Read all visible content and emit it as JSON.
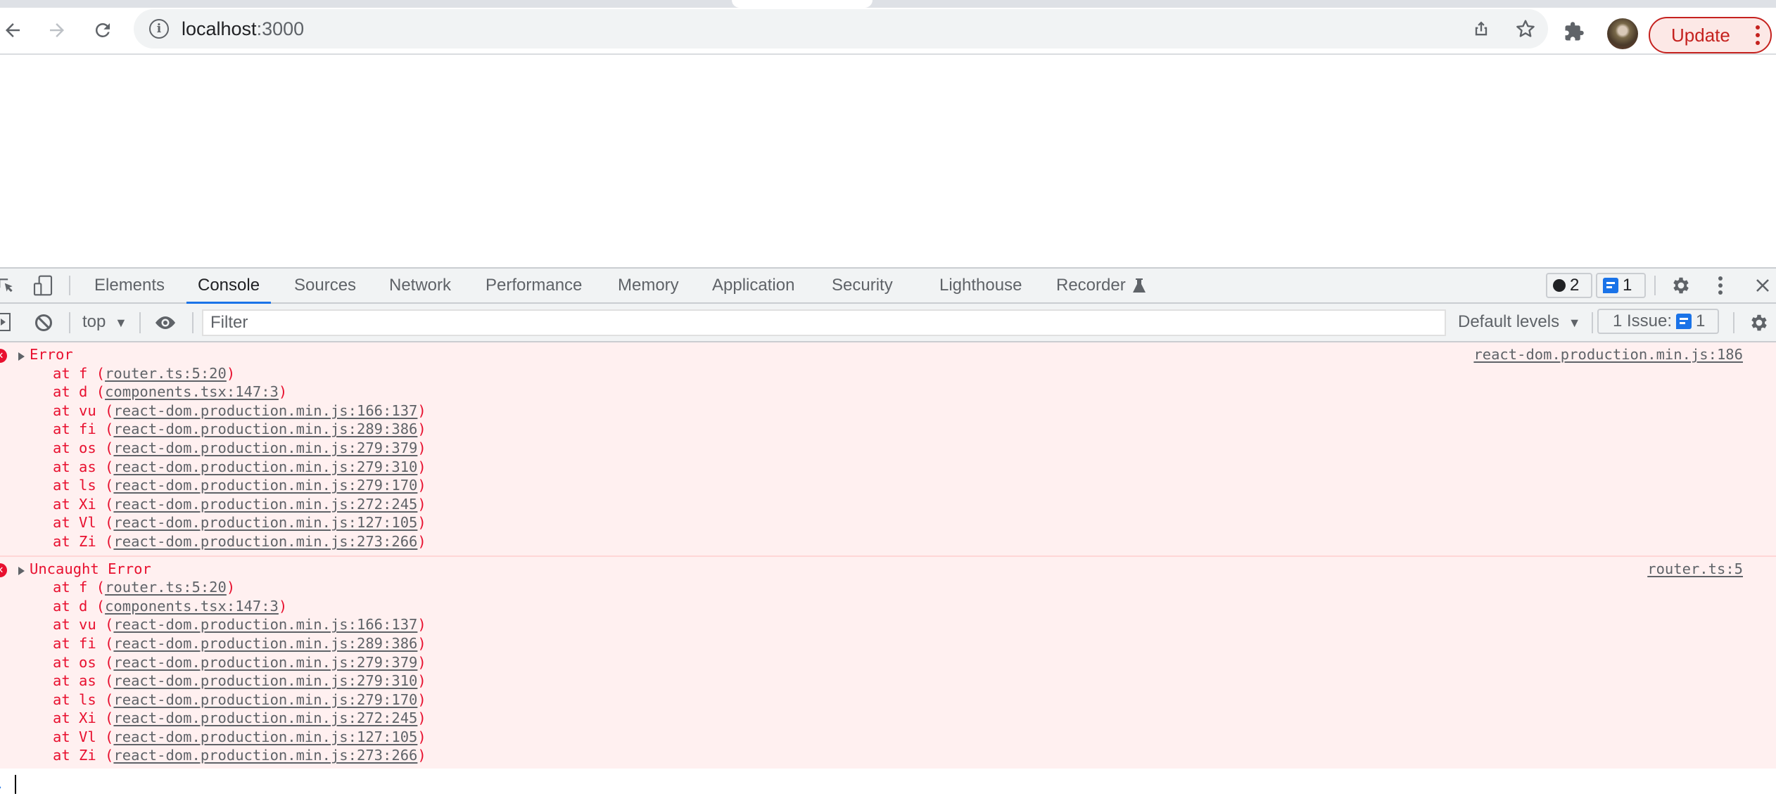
{
  "browser": {
    "url_host": "localhost",
    "url_port": ":3000",
    "update_label": "Update",
    "icons": {
      "back": "arrow-left-icon",
      "forward": "arrow-right-icon",
      "reload": "reload-icon",
      "site_info": "info-icon",
      "share": "share-icon",
      "bookmark": "star-icon",
      "extensions": "puzzle-icon",
      "profile": "avatar",
      "menu": "kebab-icon"
    }
  },
  "devtools": {
    "tabs": [
      {
        "label": "Elements",
        "active": false
      },
      {
        "label": "Console",
        "active": true
      },
      {
        "label": "Sources",
        "active": false
      },
      {
        "label": "Network",
        "active": false
      },
      {
        "label": "Performance",
        "active": false
      },
      {
        "label": "Memory",
        "active": false
      },
      {
        "label": "Application",
        "active": false
      },
      {
        "label": "Security",
        "active": false
      },
      {
        "label": "Lighthouse",
        "active": false
      },
      {
        "label": "Recorder",
        "active": false
      }
    ],
    "error_count": "2",
    "message_count": "1",
    "console_toolbar": {
      "context": "top",
      "filter_placeholder": "Filter",
      "levels": "Default levels",
      "issues_label": "1 Issue:",
      "issues_count": "1"
    },
    "accent_color": "#1a73e8",
    "error_color": "#e8102f"
  },
  "console": {
    "messages": [
      {
        "title": "Error",
        "source": "react-dom.production.min.js:186",
        "frames": [
          {
            "fn": "f",
            "loc": "router.ts:5:20"
          },
          {
            "fn": "d",
            "loc": "components.tsx:147:3"
          },
          {
            "fn": "vu",
            "loc": "react-dom.production.min.js:166:137"
          },
          {
            "fn": "fi",
            "loc": "react-dom.production.min.js:289:386"
          },
          {
            "fn": "os",
            "loc": "react-dom.production.min.js:279:379"
          },
          {
            "fn": "as",
            "loc": "react-dom.production.min.js:279:310"
          },
          {
            "fn": "ls",
            "loc": "react-dom.production.min.js:279:170"
          },
          {
            "fn": "Xi",
            "loc": "react-dom.production.min.js:272:245"
          },
          {
            "fn": "Vl",
            "loc": "react-dom.production.min.js:127:105"
          },
          {
            "fn": "Zi",
            "loc": "react-dom.production.min.js:273:266"
          }
        ]
      },
      {
        "title": "Uncaught Error",
        "source": "router.ts:5",
        "frames": [
          {
            "fn": "f",
            "loc": "router.ts:5:20"
          },
          {
            "fn": "d",
            "loc": "components.tsx:147:3"
          },
          {
            "fn": "vu",
            "loc": "react-dom.production.min.js:166:137"
          },
          {
            "fn": "fi",
            "loc": "react-dom.production.min.js:289:386"
          },
          {
            "fn": "os",
            "loc": "react-dom.production.min.js:279:379"
          },
          {
            "fn": "as",
            "loc": "react-dom.production.min.js:279:310"
          },
          {
            "fn": "ls",
            "loc": "react-dom.production.min.js:279:170"
          },
          {
            "fn": "Xi",
            "loc": "react-dom.production.min.js:272:245"
          },
          {
            "fn": "Vl",
            "loc": "react-dom.production.min.js:127:105"
          },
          {
            "fn": "Zi",
            "loc": "react-dom.production.min.js:273:266"
          }
        ]
      }
    ]
  }
}
